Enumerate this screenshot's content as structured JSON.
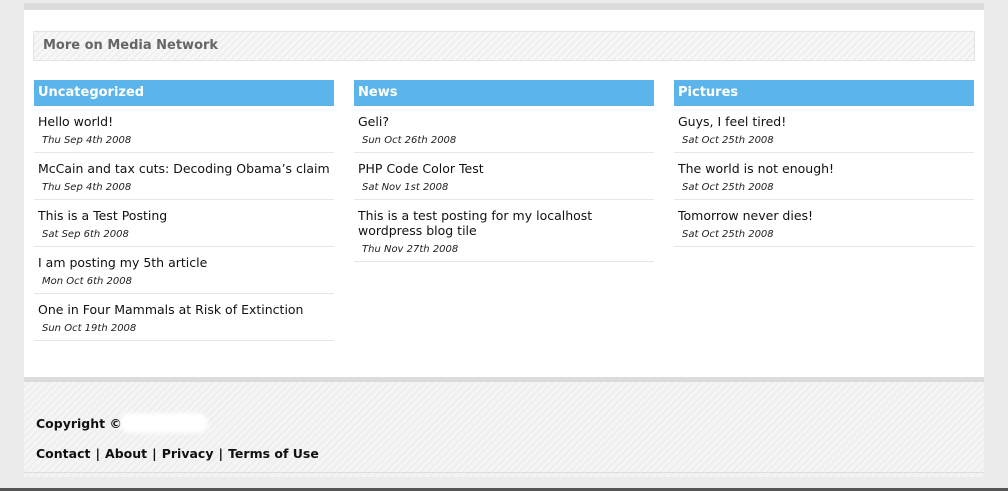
{
  "section": {
    "title": "More on Media Network"
  },
  "columns": [
    {
      "title": "Uncategorized",
      "posts": [
        {
          "title": "Hello world!",
          "date": "Thu Sep 4th 2008"
        },
        {
          "title": "McCain and tax cuts: Decoding Obama’s claim",
          "date": "Thu Sep 4th 2008"
        },
        {
          "title": "This is a Test Posting",
          "date": "Sat Sep 6th 2008"
        },
        {
          "title": "I am posting my 5th article",
          "date": "Mon Oct 6th 2008"
        },
        {
          "title": "One in Four Mammals at Risk of Extinction",
          "date": "Sun Oct 19th 2008"
        }
      ]
    },
    {
      "title": "News",
      "posts": [
        {
          "title": "Geli?",
          "date": "Sun Oct 26th 2008"
        },
        {
          "title": "PHP Code Color Test",
          "date": "Sat Nov 1st 2008"
        },
        {
          "title": "This is a test posting for my localhost wordpress blog tile",
          "date": "Thu Nov 27th 2008"
        }
      ]
    },
    {
      "title": "Pictures",
      "posts": [
        {
          "title": "Guys, I feel tired!",
          "date": "Sat Oct 25th 2008"
        },
        {
          "title": "The world is not enough!",
          "date": "Sat Oct 25th 2008"
        },
        {
          "title": "Tomorrow never dies!",
          "date": "Sat Oct 25th 2008"
        }
      ]
    }
  ],
  "footer": {
    "copyright": "Copyright ©",
    "links": [
      "Contact",
      "About",
      "Privacy",
      "Terms of Use"
    ],
    "separator": "|"
  },
  "colors": {
    "accent": "#5cb5ea"
  }
}
